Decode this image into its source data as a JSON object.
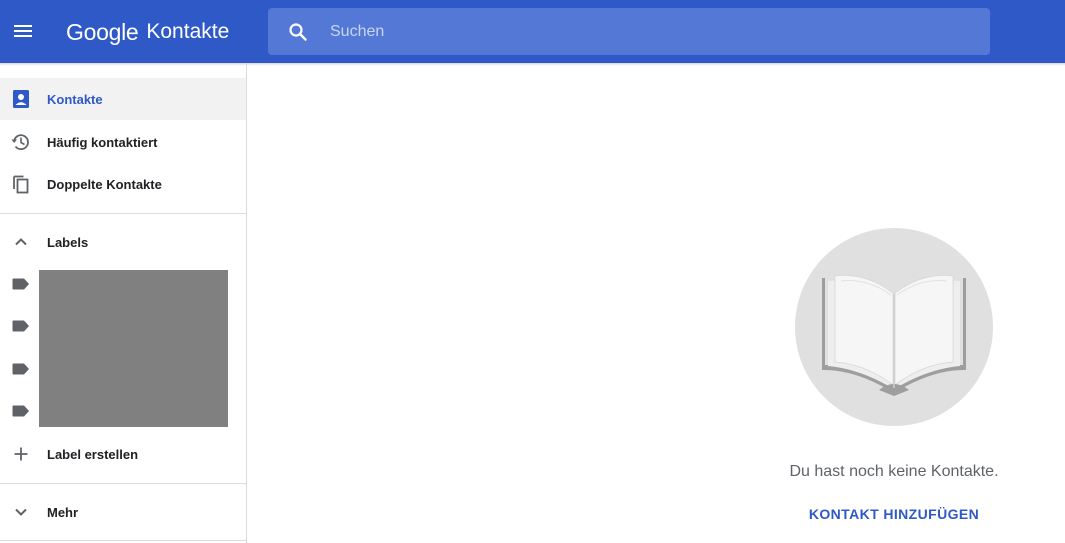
{
  "app": {
    "logo_google": "Google",
    "logo_product": "Kontakte"
  },
  "search": {
    "placeholder": "Suchen",
    "value": ""
  },
  "sidebar": {
    "items": [
      {
        "label": "Kontakte",
        "icon": "contacts-icon",
        "active": true
      },
      {
        "label": "Häufig kontaktiert",
        "icon": "history-icon",
        "active": false
      },
      {
        "label": "Doppelte Kontakte",
        "icon": "copy-icon",
        "active": false
      }
    ],
    "labels_section": {
      "label": "Labels",
      "icon": "chevron-up-icon",
      "label_icons": [
        "label-icon",
        "label-icon",
        "label-icon",
        "label-icon"
      ],
      "create_label": "Label erstellen"
    },
    "more": {
      "label": "Mehr",
      "icon": "chevron-down-icon"
    }
  },
  "empty_state": {
    "message": "Du hast noch keine Kontakte.",
    "action_label": "KONTAKT HINZUFÜGEN",
    "illustration": "open-book-icon"
  },
  "colors": {
    "header": "#2f59c7",
    "search_bg": "#5478d5",
    "accent": "#2f59c7",
    "active_bg": "#f2f2f2",
    "redacted_block": "#808080",
    "illustration_circle": "#e0e0e0"
  }
}
